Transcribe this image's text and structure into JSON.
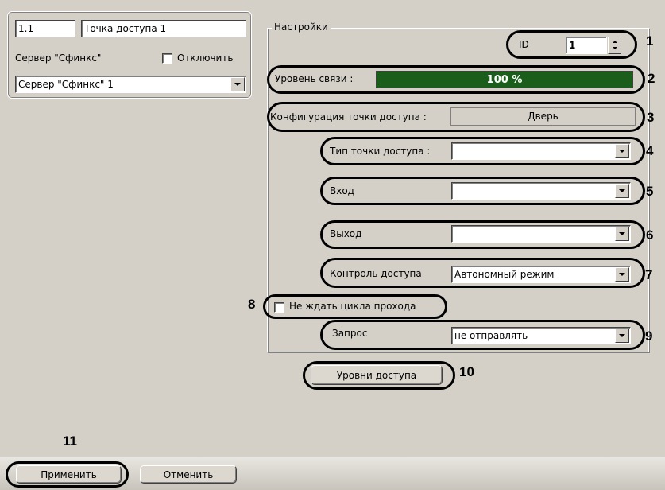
{
  "left_panel": {
    "number": "1.1",
    "name": "Точка доступа 1",
    "server_label": "Сервер \"Сфинкс\"",
    "disable_label": "Отключить",
    "server_value": "Сервер \"Сфинкс\" 1"
  },
  "settings": {
    "title": "Настройки",
    "id_label": "ID",
    "id_value": "1",
    "link_label": "Уровень связи :",
    "link_value": "100 %",
    "link_level": 1.0,
    "config_label": "Конфигурация точки доступа :",
    "config_value": "Дверь",
    "type_label": "Тип точки доступа :",
    "type_value": "",
    "input_label": "Вход",
    "input_value": "",
    "output_label": "Выход",
    "output_value": "",
    "control_label": "Контроль доступа",
    "control_value": "Автономный режим",
    "no_wait_label": "Не ждать цикла прохода",
    "request_label": "Запрос",
    "request_value": "не отправлять",
    "levels_button": "Уровни доступа"
  },
  "footer": {
    "apply": "Применить",
    "cancel": "Отменить"
  },
  "callouts": [
    "1",
    "2",
    "3",
    "4",
    "5",
    "6",
    "7",
    "8",
    "9",
    "10",
    "11"
  ],
  "colors": {
    "link_bar": "#1b5e1b",
    "background": "#d4d0c8"
  }
}
